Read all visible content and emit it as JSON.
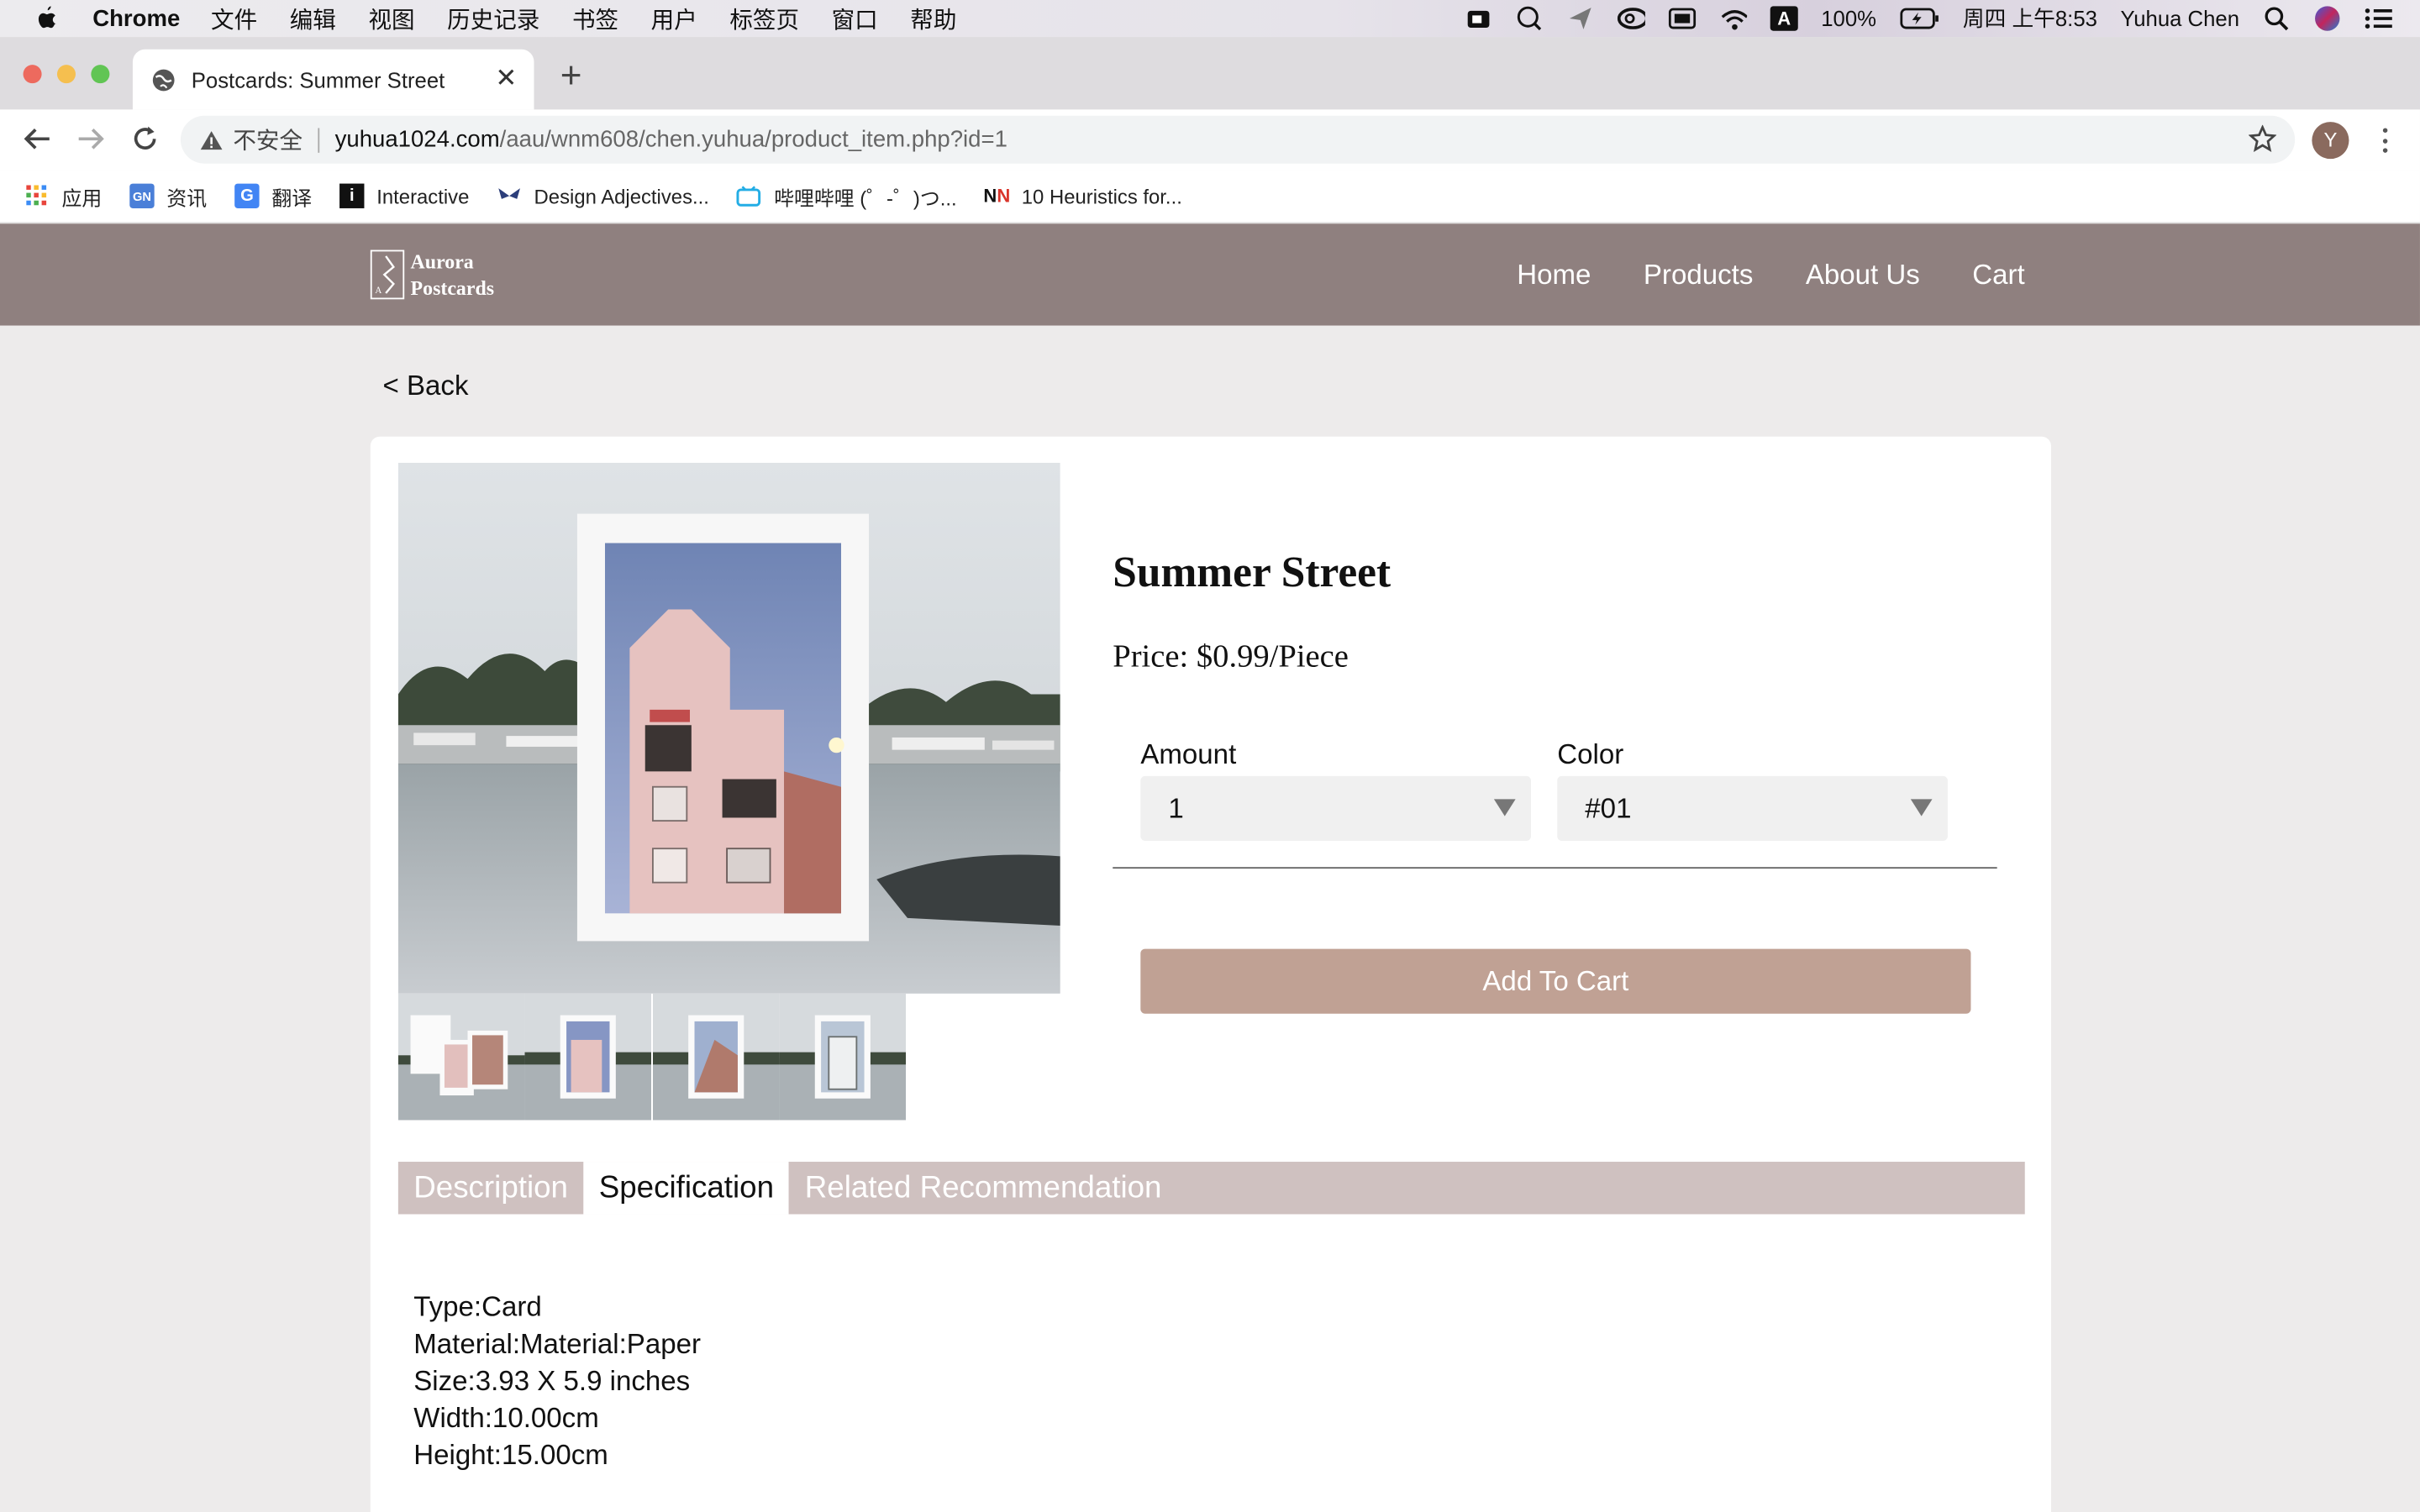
{
  "menubar": {
    "app_name": "Chrome",
    "items": [
      "文件",
      "编辑",
      "视图",
      "历史记录",
      "书签",
      "用户",
      "标签页",
      "窗口",
      "帮助"
    ],
    "battery": "100%",
    "datetime": "周四 上午8:53",
    "user": "Yuhua Chen",
    "input_method": "A"
  },
  "browser": {
    "tab_title": "Postcards: Summer Street",
    "security_label": "不安全",
    "url_host": "yuhua1024.com",
    "url_path": "/aau/wnm608/chen.yuhua/product_item.php?id=1",
    "profile_initial": "Y",
    "bookmarks": [
      {
        "label": "应用",
        "icon": "apps-grid-icon"
      },
      {
        "label": "资讯",
        "icon": "news-icon"
      },
      {
        "label": "翻译",
        "icon": "translate-icon"
      },
      {
        "label": "Interactive",
        "icon": "interactive-icon"
      },
      {
        "label": "Design Adjectives...",
        "icon": "butterfly-icon"
      },
      {
        "label": "哔哩哔哩 (゜-゜)つ...",
        "icon": "bilibili-icon"
      },
      {
        "label": "10 Heuristics for...",
        "icon": "nn-icon"
      }
    ]
  },
  "site": {
    "logo_line1": "Aurora",
    "logo_line2": "Postcards",
    "nav": [
      "Home",
      "Products",
      "About Us",
      "Cart"
    ],
    "header_color": "#8f807f"
  },
  "product": {
    "back_label": "< Back",
    "title": "Summer Street",
    "price": "Price: $0.99/Piece",
    "amount_label": "Amount",
    "amount_value": "1",
    "color_label": "Color",
    "color_value": "#01",
    "add_to_cart": "Add To Cart",
    "accent_color": "#c0a194",
    "tabs": [
      "Description",
      "Specification",
      "Related Recommendation"
    ],
    "active_tab": "Specification",
    "specs": [
      "Type:Card",
      "Material:Material:Paper",
      "Size:3.93 X 5.9 inches",
      "Width:10.00cm",
      "Height:15.00cm"
    ]
  }
}
